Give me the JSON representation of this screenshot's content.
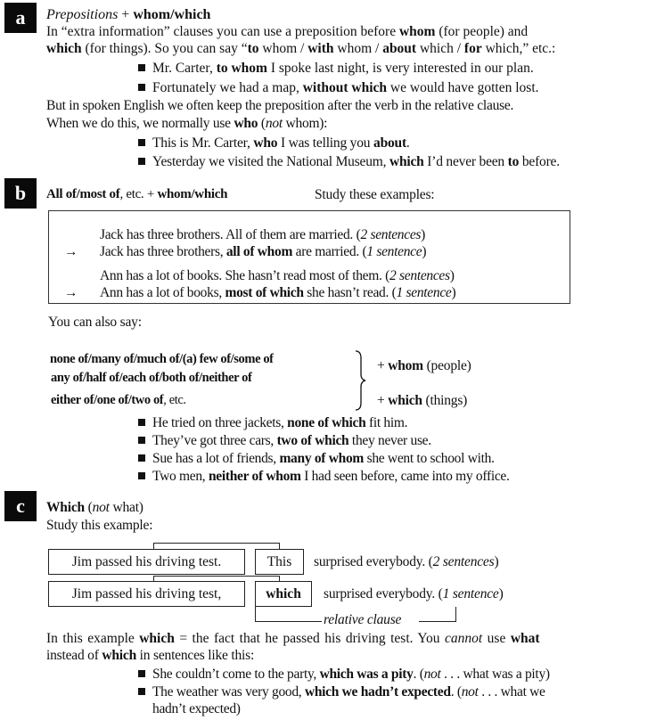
{
  "section_a": {
    "badge": "a",
    "title_italic": "Prepositions",
    "title_plus": " + ",
    "title_bold": "whom/which",
    "p1": [
      {
        "t": "In “extra information” clauses you can use a preposition before ",
        "s": "n"
      },
      {
        "t": "whom",
        "s": "b"
      },
      {
        "t": " (for people) and",
        "s": "n"
      }
    ],
    "p2": [
      {
        "t": "which",
        "s": "b"
      },
      {
        "t": " (for things). So you can say “",
        "s": "n"
      },
      {
        "t": "to",
        "s": "b"
      },
      {
        "t": " whom / ",
        "s": "n"
      },
      {
        "t": "with",
        "s": "b"
      },
      {
        "t": " whom / ",
        "s": "n"
      },
      {
        "t": "about",
        "s": "b"
      },
      {
        "t": " which / ",
        "s": "n"
      },
      {
        "t": "for",
        "s": "b"
      },
      {
        "t": " which,” etc.:",
        "s": "n"
      }
    ],
    "bullets1": [
      [
        {
          "t": "Mr. Carter, ",
          "s": "n"
        },
        {
          "t": "to whom",
          "s": "b"
        },
        {
          "t": " I spoke last night, is very interested in our plan.",
          "s": "n"
        }
      ],
      [
        {
          "t": "Fortunately we had a map, ",
          "s": "n"
        },
        {
          "t": "without which",
          "s": "b"
        },
        {
          "t": " we would have gotten lost.",
          "s": "n"
        }
      ]
    ],
    "p3": [
      {
        "t": "But in spoken English we often keep the preposition after the verb in the relative clause.",
        "s": "n"
      }
    ],
    "p4": [
      {
        "t": "When we do this, we normally use ",
        "s": "n"
      },
      {
        "t": "who",
        "s": "b"
      },
      {
        "t": " (",
        "s": "n"
      },
      {
        "t": "not",
        "s": "i"
      },
      {
        "t": " whom):",
        "s": "n"
      }
    ],
    "bullets2": [
      [
        {
          "t": "This is Mr. Carter, ",
          "s": "n"
        },
        {
          "t": "who",
          "s": "b"
        },
        {
          "t": " I was telling you ",
          "s": "n"
        },
        {
          "t": "about",
          "s": "b"
        },
        {
          "t": ".",
          "s": "n"
        }
      ],
      [
        {
          "t": "Yesterday we visited the National Museum, ",
          "s": "n"
        },
        {
          "t": "which",
          "s": "b"
        },
        {
          "t": " I’d never been ",
          "s": "n"
        },
        {
          "t": "to",
          "s": "b"
        },
        {
          "t": " before.",
          "s": "n"
        }
      ]
    ]
  },
  "section_b": {
    "badge": "b",
    "title": [
      {
        "t": "All of/most of",
        "s": "b"
      },
      {
        "t": ", etc. + ",
        "s": "n"
      },
      {
        "t": "whom/which",
        "s": "b"
      }
    ],
    "study": "Study these examples:",
    "box_lines": [
      {
        "arrow": "",
        "parts": [
          {
            "t": "Jack has three brothers. All of them are married. (",
            "s": "n"
          },
          {
            "t": "2 sentences",
            "s": "i"
          },
          {
            "t": ")",
            "s": "n"
          }
        ]
      },
      {
        "arrow": "→",
        "parts": [
          {
            "t": "Jack has three brothers, ",
            "s": "n"
          },
          {
            "t": "all of whom",
            "s": "b"
          },
          {
            "t": " are married. (",
            "s": "n"
          },
          {
            "t": "1 sentence",
            "s": "i"
          },
          {
            "t": ")",
            "s": "n"
          }
        ]
      },
      {
        "arrow": "",
        "parts": [
          {
            "t": "Ann has a lot of books. She hasn’t read most of them. (",
            "s": "n"
          },
          {
            "t": "2 sentences",
            "s": "i"
          },
          {
            "t": ")",
            "s": "n"
          }
        ]
      },
      {
        "arrow": "→",
        "parts": [
          {
            "t": "Ann has a lot of books, ",
            "s": "n"
          },
          {
            "t": "most of which",
            "s": "b"
          },
          {
            "t": " she hasn’t read. (",
            "s": "n"
          },
          {
            "t": "1 sentence",
            "s": "i"
          },
          {
            "t": ")",
            "s": "n"
          }
        ]
      }
    ],
    "also_say": "You can also say:",
    "quantifiers": [
      [
        {
          "t": "none of/many of/much of/(a) few of/some of",
          "s": "b"
        }
      ],
      [
        {
          "t": "any of/half of/each of/both of/neither of",
          "s": "b"
        }
      ],
      [
        {
          "t": "either of/one of/two of",
          "s": "b"
        },
        {
          "t": ", etc.",
          "s": "n"
        }
      ]
    ],
    "whom_line": [
      {
        "t": "+ ",
        "s": "n"
      },
      {
        "t": "whom",
        "s": "b"
      },
      {
        "t": " (people)",
        "s": "n"
      }
    ],
    "which_line": [
      {
        "t": "+ ",
        "s": "n"
      },
      {
        "t": "which",
        "s": "b"
      },
      {
        "t": " (things)",
        "s": "n"
      }
    ],
    "bullets": [
      [
        {
          "t": "He tried on three jackets, ",
          "s": "n"
        },
        {
          "t": "none of which",
          "s": "b"
        },
        {
          "t": " fit him.",
          "s": "n"
        }
      ],
      [
        {
          "t": "They’ve got three cars, ",
          "s": "n"
        },
        {
          "t": "two of which",
          "s": "b"
        },
        {
          "t": " they never use.",
          "s": "n"
        }
      ],
      [
        {
          "t": "Sue has a lot of friends, ",
          "s": "n"
        },
        {
          "t": "many of whom",
          "s": "b"
        },
        {
          "t": " she went to school with.",
          "s": "n"
        }
      ],
      [
        {
          "t": "Two men, ",
          "s": "n"
        },
        {
          "t": "neither of whom",
          "s": "b"
        },
        {
          "t": " I had seen before, came into my office.",
          "s": "n"
        }
      ]
    ]
  },
  "section_c": {
    "badge": "c",
    "title": [
      {
        "t": "Which",
        "s": "b"
      },
      {
        "t": " (",
        "s": "n"
      },
      {
        "t": "not",
        "s": "i"
      },
      {
        "t": " what)",
        "s": "n"
      }
    ],
    "study": "Study this example:",
    "diagram": {
      "row1_box1": "Jim passed his driving test.",
      "row1_box2": "This",
      "row1_rest": [
        {
          "t": "surprised everybody. (",
          "s": "n"
        },
        {
          "t": "2 sentences",
          "s": "i"
        },
        {
          "t": ")",
          "s": "n"
        }
      ],
      "row2_box1": "Jim passed his driving test,",
      "row2_box2": "which",
      "row2_rest": [
        {
          "t": "surprised everybody. (",
          "s": "n"
        },
        {
          "t": "1 sentence",
          "s": "i"
        },
        {
          "t": ")",
          "s": "n"
        }
      ],
      "bracket_label": "relative clause"
    },
    "p1": [
      {
        "t": "In this example ",
        "s": "n"
      },
      {
        "t": "which",
        "s": "b"
      },
      {
        "t": " = the fact that he passed his driving test. You ",
        "s": "n"
      },
      {
        "t": "cannot",
        "s": "i"
      },
      {
        "t": " use ",
        "s": "n"
      },
      {
        "t": "what",
        "s": "b"
      }
    ],
    "p2": [
      {
        "t": "instead of ",
        "s": "n"
      },
      {
        "t": "which",
        "s": "b"
      },
      {
        "t": " in sentences like this:",
        "s": "n"
      }
    ],
    "bullets": [
      [
        {
          "t": "She couldn’t come to the party, ",
          "s": "n"
        },
        {
          "t": "which was a pity",
          "s": "b"
        },
        {
          "t": ". (",
          "s": "n"
        },
        {
          "t": "not",
          "s": "i"
        },
        {
          "t": " . . . what was a pity)",
          "s": "n"
        }
      ],
      [
        {
          "t": "The weather was very good, ",
          "s": "n"
        },
        {
          "t": "which we hadn’t expected",
          "s": "b"
        },
        {
          "t": ". (",
          "s": "n"
        },
        {
          "t": "not",
          "s": "i"
        },
        {
          "t": " . . . what we",
          "s": "n"
        }
      ]
    ],
    "bullet2_cont": "hadn’t expected)"
  }
}
